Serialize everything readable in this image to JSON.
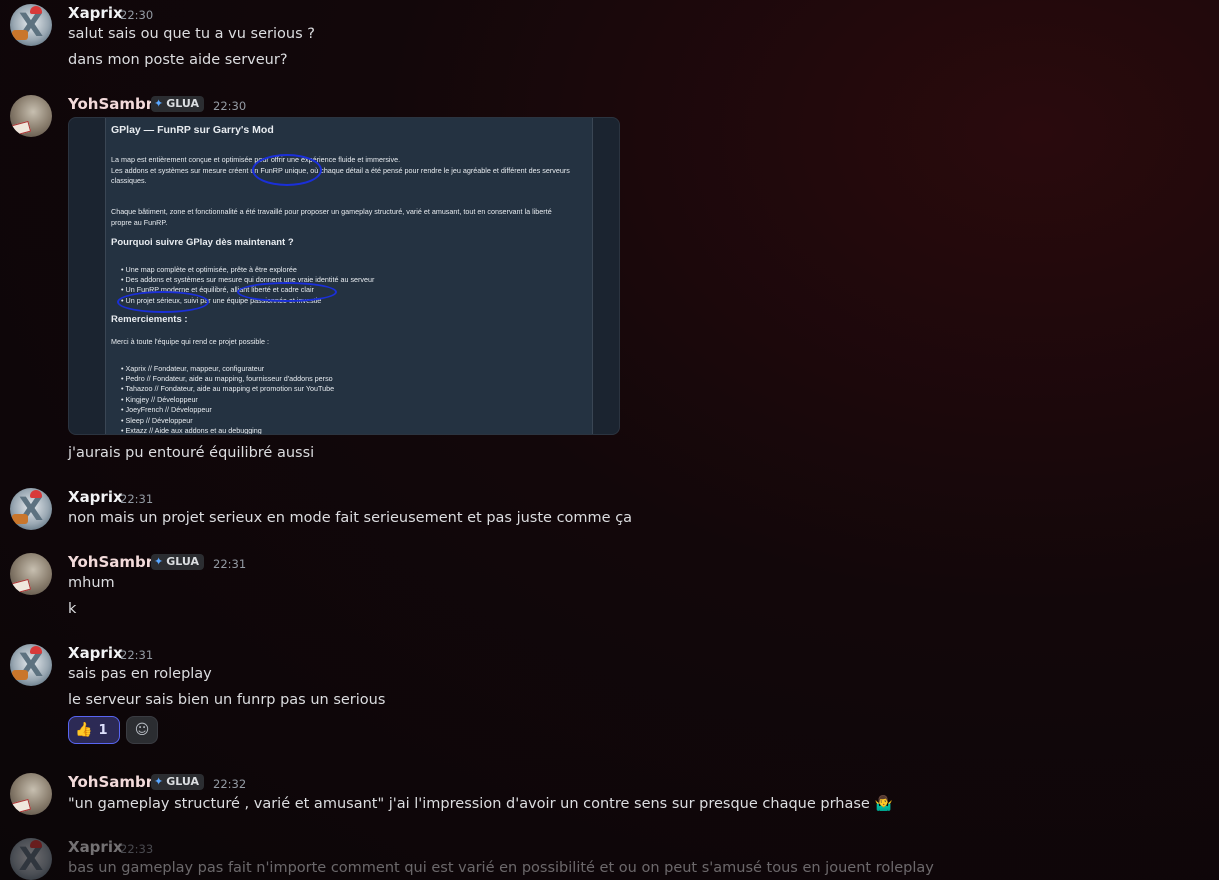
{
  "messages": [
    {
      "author": "Xaprix",
      "time": "22:30",
      "lines": [
        "salut sais ou que tu a vu serious ?",
        "dans mon poste aide serveur?"
      ]
    },
    {
      "author": "YohSambre",
      "badge": "GLUA",
      "time": "22:30",
      "after_image": "j'aurais pu entouré équilibré aussi"
    },
    {
      "author": "Xaprix",
      "time": "22:31",
      "lines": [
        "non mais un projet serieux en mode fait serieusement et pas juste comme ça"
      ]
    },
    {
      "author": "YohSambre",
      "badge": "GLUA",
      "time": "22:31",
      "lines": [
        "mhum",
        "k"
      ]
    },
    {
      "author": "Xaprix",
      "time": "22:31",
      "lines": [
        "sais pas en roleplay",
        "le serveur sais bien un funrp pas un serious"
      ],
      "reactions": [
        {
          "emoji": "👍",
          "count": "1"
        },
        {
          "emoji": "☺"
        }
      ]
    },
    {
      "author": "YohSambre",
      "badge": "GLUA",
      "time": "22:32",
      "lines": [
        "\"un gameplay structuré , varié et amusant\" j'ai l'impression d'avoir un contre sens sur presque chaque prhase 🤷‍♂️"
      ]
    },
    {
      "author": "Xaprix",
      "time": "22:33",
      "lines": [
        "bas un gameplay pas fait n'importe comment qui est varié en possibilité et ou on peut s'amusé tous en jouent roleplay"
      ]
    }
  ],
  "embed": {
    "title": "GPlay — FunRP sur Garry's Mod",
    "p1a": "La map est entièrement conçue et optimisée pour offrir une expérience fluide et immersive.",
    "p1b": "Les addons et systèmes sur mesure créent un FunRP unique, où chaque détail a été pensé pour rendre le jeu agréable et différent des serveurs",
    "p1c": "classiques.",
    "p2a": "Chaque bâtiment, zone et fonctionnalité a été travaillé pour proposer un gameplay structuré, varié et amusant, tout en conservant la liberté",
    "p2b": "propre au FunRP.",
    "h2": "Pourquoi suivre GPlay dès maintenant ?",
    "bullets": [
      "• Une map complète et optimisée, prête à être explorée",
      "• Des addons et systèmes sur mesure qui donnent une vraie identité au serveur",
      "• Un FunRP moderne et équilibré, alliant liberté et cadre clair",
      "• Un projet sérieux, suivi par une équipe passionnée et investie"
    ],
    "h3": "Remerciements :",
    "thanks": "Merci à toute l'équipe qui rend ce projet possible :",
    "team": [
      "• Xaprix // Fondateur, mappeur, configurateur",
      "• Pedro // Fondateur, aide au mapping, fournisseur d'addons perso",
      "• Tahazoo // Fondateur, aide au mapping et promotion sur YouTube",
      "• Kingjey // Développeur",
      "• JoeyFrench // Développeur",
      "• Sleep // Développeur",
      "• Extazz // Aide aux addons et au debugging"
    ]
  }
}
